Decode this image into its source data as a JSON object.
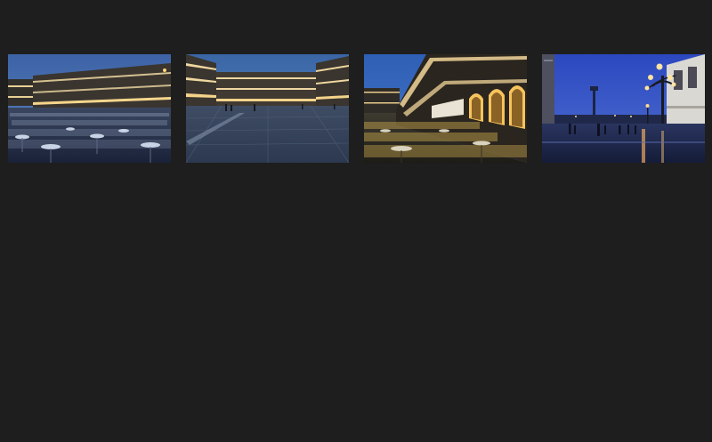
{
  "gallery": {
    "background_color": "#1e1e1e",
    "photos": [
      {
        "subject": "piazza-cafe-tables-dusk",
        "sky_color": "#3b5f9f",
        "light_color": "#f3d79a"
      },
      {
        "subject": "empty-piazza-wet-pavement",
        "sky_color": "#3d6aa8",
        "light_color": "#f1d6a0"
      },
      {
        "subject": "arcade-cafe-golden-chairs",
        "sky_color": "#2f5fb4",
        "light_color": "#f6c86a"
      },
      {
        "subject": "waterfront-street-lamps-blue-hour",
        "sky_color": "#2d4ec4",
        "light_color": "#ffd98a"
      }
    ]
  }
}
